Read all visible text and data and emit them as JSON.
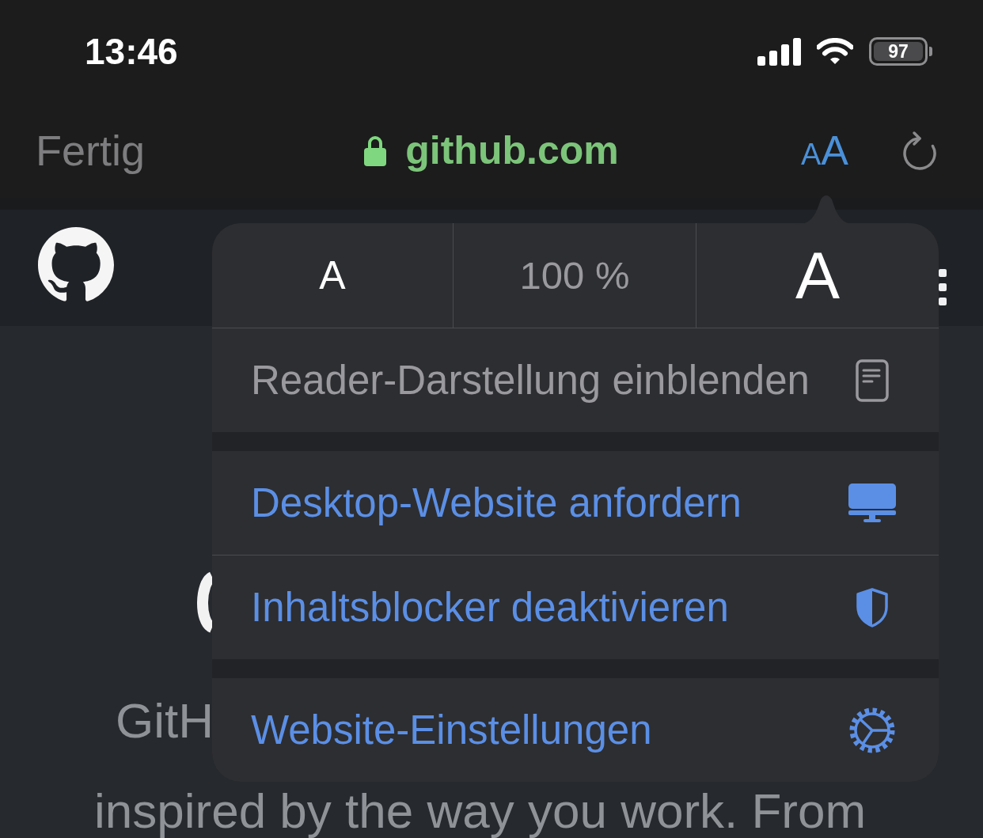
{
  "status_bar": {
    "time": "13:46",
    "battery": "97"
  },
  "toolbar": {
    "done": "Fertig",
    "address": "github.com",
    "text_button": {
      "small": "A",
      "large": "A"
    }
  },
  "page": {
    "intro_lines": [
      "GitH",
      "inspired by the way you work. From"
    ]
  },
  "popover": {
    "zoom": {
      "smaller": "A",
      "level": "100 %",
      "larger": "A"
    },
    "sections": [
      {
        "items": [
          {
            "label": "Reader-Darstellung einblenden",
            "disabled": true
          }
        ]
      },
      {
        "items": [
          {
            "label": "Desktop-Website anfordern",
            "disabled": false
          },
          {
            "label": "Inhaltsblocker deaktivieren",
            "disabled": false
          }
        ]
      },
      {
        "items": [
          {
            "label": "Website-Einstellungen",
            "disabled": false
          }
        ]
      }
    ]
  }
}
